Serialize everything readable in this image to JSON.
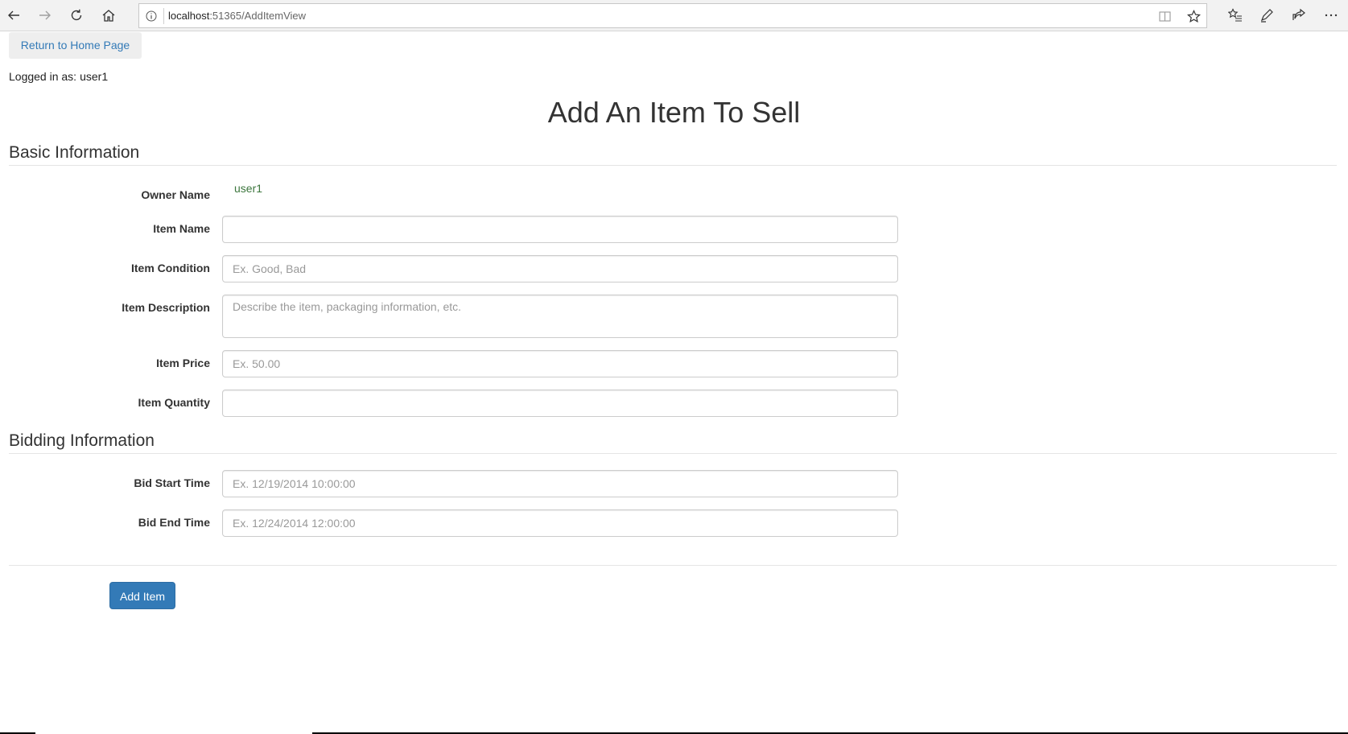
{
  "browser": {
    "url_host": "localhost",
    "url_path": ":51365/AddItemView"
  },
  "nav": {
    "home_link": "Return to Home Page"
  },
  "session": {
    "logged_in_label": "Logged in as:",
    "username": "user1"
  },
  "page": {
    "title": "Add An Item To Sell"
  },
  "basic_info": {
    "heading": "Basic Information",
    "owner_name_label": "Owner Name",
    "owner_name_value": "user1",
    "item_name_label": "Item Name",
    "item_name_value": "",
    "item_condition_label": "Item Condition",
    "item_condition_placeholder": "Ex. Good, Bad",
    "item_description_label": "Item Description",
    "item_description_placeholder": "Describe the item, packaging information, etc.",
    "item_price_label": "Item Price",
    "item_price_placeholder": "Ex. 50.00",
    "item_quantity_label": "Item Quantity",
    "item_quantity_value": ""
  },
  "bidding_info": {
    "heading": "Bidding Information",
    "bid_start_label": "Bid Start Time",
    "bid_start_placeholder": "Ex. 12/19/2014 10:00:00",
    "bid_end_label": "Bid End Time",
    "bid_end_placeholder": "Ex. 12/24/2014 12:00:00"
  },
  "actions": {
    "submit_label": "Add Item"
  },
  "colors": {
    "link": "#337ab7",
    "primary_button": "#337ab7",
    "static_value": "#3c763d"
  }
}
